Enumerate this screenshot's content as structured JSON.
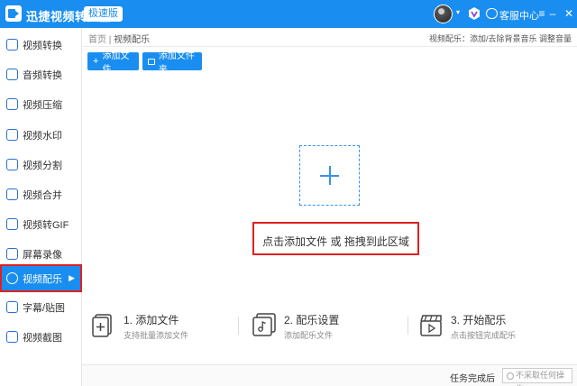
{
  "titlebar": {
    "app_name": "迅捷视频转换器",
    "edition": "极速版",
    "service_label": "客服中心"
  },
  "sidebar": {
    "items": [
      {
        "label": "视频转换",
        "icon": "video-convert-icon"
      },
      {
        "label": "音频转换",
        "icon": "audio-convert-icon"
      },
      {
        "label": "视频压缩",
        "icon": "video-compress-icon"
      },
      {
        "label": "视频水印",
        "icon": "video-watermark-icon"
      },
      {
        "label": "视频分割",
        "icon": "video-split-icon"
      },
      {
        "label": "视频合并",
        "icon": "video-merge-icon"
      },
      {
        "label": "视频转GIF",
        "icon": "video-gif-icon"
      },
      {
        "label": "屏幕录像",
        "icon": "screen-record-icon"
      },
      {
        "label": "视频配乐",
        "icon": "video-music-icon",
        "active": true
      },
      {
        "label": "字幕/贴图",
        "icon": "subtitle-icon"
      },
      {
        "label": "视频截图",
        "icon": "screenshot-icon"
      }
    ]
  },
  "breadcrumb": {
    "home": "首页",
    "separator": "|",
    "current": "视频配乐"
  },
  "hint": "视频配乐：添加/去除背景音乐 调整音量",
  "toolbar": {
    "add_file": "添加文件",
    "add_folder": "添加文件夹"
  },
  "dropzone": {
    "text": "点击添加文件 或 拖拽到此区域"
  },
  "steps": [
    {
      "title": "1. 添加文件",
      "desc": "支持批量添加文件",
      "icon": "add-file-icon"
    },
    {
      "title": "2. 配乐设置",
      "desc": "添加配乐文件",
      "icon": "music-settings-icon"
    },
    {
      "title": "3. 开始配乐",
      "desc": "点击按钮完成配乐",
      "icon": "start-icon"
    }
  ],
  "footer": {
    "label": "任务完成后",
    "select_value": "不采取任何操作"
  },
  "colors": {
    "accent": "#1a8ef0",
    "highlight_border": "#e02020"
  }
}
